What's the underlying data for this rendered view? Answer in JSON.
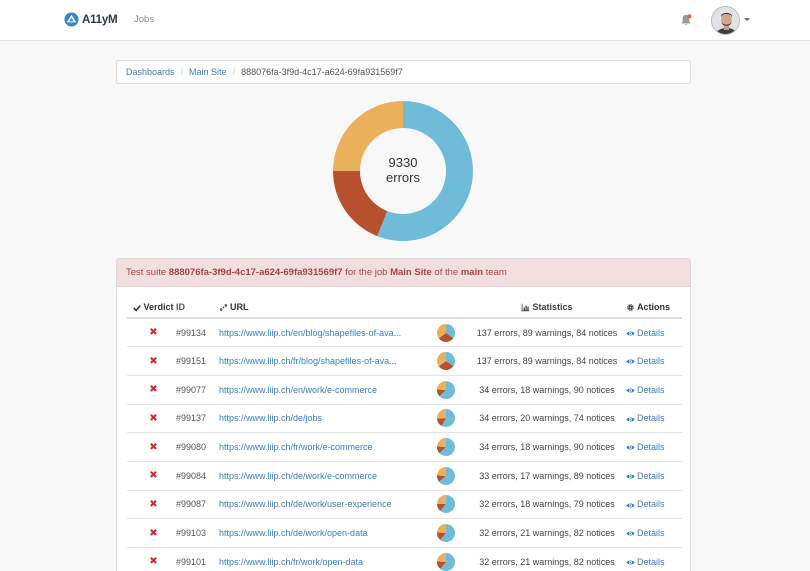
{
  "header": {
    "brand": "A11yM",
    "nav_jobs": "Jobs",
    "icons": [
      "logo-icon",
      "bell-icon",
      "avatar",
      "caret-down-icon"
    ]
  },
  "breadcrumb": {
    "items": [
      "Dashboards",
      "Main Site"
    ],
    "current": "888076fa-3f9d-4c17-a624-69fa931569f7"
  },
  "summary": {
    "count": "9330",
    "unit": "errors",
    "segments": [
      {
        "name": "errors",
        "color": "#6fbcd9",
        "fraction": 0.56
      },
      {
        "name": "red",
        "color": "#b6502f",
        "fraction": 0.19
      },
      {
        "name": "orange",
        "color": "#ebb05c",
        "fraction": 0.25
      }
    ]
  },
  "panel": {
    "prefix": "Test suite ",
    "suite_id": "888076fa-3f9d-4c17-a624-69fa931569f7",
    "mid1": " for the job ",
    "job": "Main Site",
    "mid2": " of the ",
    "team": "main",
    "suffix": " team"
  },
  "table": {
    "headers": {
      "verdict": "Verdict",
      "id": "ID",
      "url": "URL",
      "statistics": "Statistics",
      "actions": "Actions"
    },
    "rows": [
      {
        "verdict": "✖",
        "id": "#99134",
        "url": "https://www.liip.ch/en/blog/shapefiles-of-ava...",
        "stats": "137 errors, 89 warnings, 84 notices",
        "action": "Details",
        "pie": {
          "blue": 0.35,
          "red": 0.3,
          "orange": 0.35
        }
      },
      {
        "verdict": "✖",
        "id": "#99151",
        "url": "https://www.liip.ch/fr/blog/shapefiles-of-ava...",
        "stats": "137 errors, 89 warnings, 84 notices",
        "action": "Details",
        "pie": {
          "blue": 0.35,
          "red": 0.3,
          "orange": 0.35
        }
      },
      {
        "verdict": "✖",
        "id": "#99077",
        "url": "https://www.liip.ch/en/work/e-commerce",
        "stats": "34 errors, 18 warnings, 90 notices",
        "action": "Details",
        "pie": {
          "blue": 0.63,
          "red": 0.13,
          "orange": 0.24
        }
      },
      {
        "verdict": "✖",
        "id": "#99137",
        "url": "https://www.liip.ch/de/jobs",
        "stats": "34 errors, 20 warnings, 74 notices",
        "action": "Details",
        "pie": {
          "blue": 0.58,
          "red": 0.16,
          "orange": 0.26
        }
      },
      {
        "verdict": "✖",
        "id": "#99080",
        "url": "https://www.liip.ch/fr/work/e-commerce",
        "stats": "34 errors, 18 warnings, 90 notices",
        "action": "Details",
        "pie": {
          "blue": 0.63,
          "red": 0.13,
          "orange": 0.24
        }
      },
      {
        "verdict": "✖",
        "id": "#99084",
        "url": "https://www.liip.ch/de/work/e-commerce",
        "stats": "33 errors, 17 warnings, 89 notices",
        "action": "Details",
        "pie": {
          "blue": 0.64,
          "red": 0.12,
          "orange": 0.24
        }
      },
      {
        "verdict": "✖",
        "id": "#99087",
        "url": "https://www.liip.ch/de/work/user-experience",
        "stats": "32 errors, 18 warnings, 79 notices",
        "action": "Details",
        "pie": {
          "blue": 0.61,
          "red": 0.14,
          "orange": 0.25
        }
      },
      {
        "verdict": "✖",
        "id": "#99103",
        "url": "https://www.liip.ch/de/work/open-data",
        "stats": "32 errors, 21 warnings, 82 notices",
        "action": "Details",
        "pie": {
          "blue": 0.61,
          "red": 0.15,
          "orange": 0.24
        }
      },
      {
        "verdict": "✖",
        "id": "#99101",
        "url": "https://www.liip.ch/fr/work/open-data",
        "stats": "32 errors, 21 warnings, 82 notices",
        "action": "Details",
        "pie": {
          "blue": 0.61,
          "red": 0.15,
          "orange": 0.24
        }
      }
    ]
  },
  "colors": {
    "link": "#3a7fbf",
    "danger": "#c9302c",
    "alert_bg": "#f2dede",
    "alert_text": "#a94442",
    "pie_blue": "#6fbcd9",
    "pie_red": "#b6502f",
    "pie_orange": "#ebb05c"
  }
}
